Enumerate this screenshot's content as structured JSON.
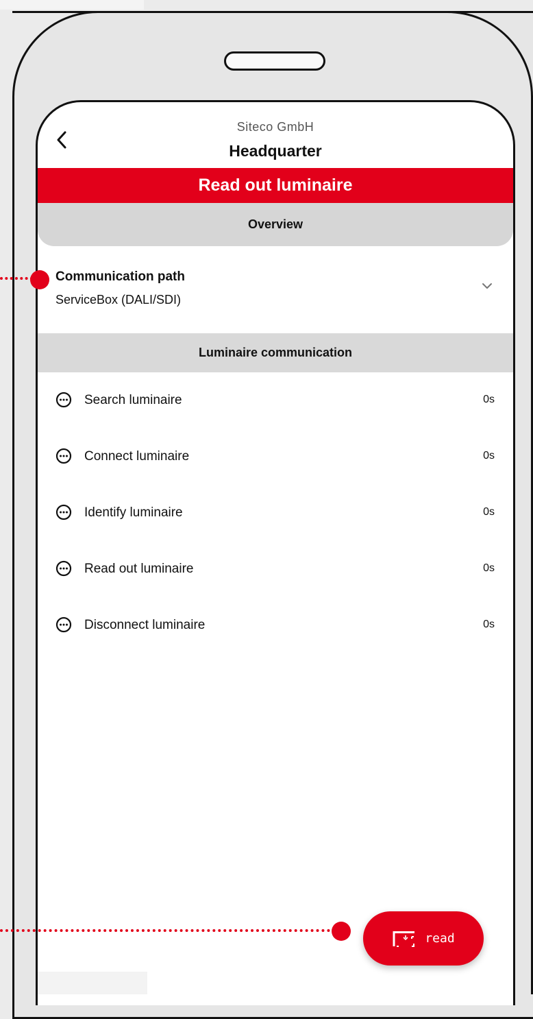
{
  "header": {
    "company": "Siteco GmbH",
    "site": "Headquarter",
    "back_icon": "chevron-left-icon"
  },
  "banner": {
    "title": "Read out luminaire"
  },
  "overview": {
    "label": "Overview"
  },
  "communication_path": {
    "label": "Communication path",
    "value": "ServiceBox (DALI/SDI)",
    "icon": "chevron-down-icon"
  },
  "luminaire_communication": {
    "label": "Luminaire communication",
    "steps": [
      {
        "name": "Search luminaire",
        "time": "0s",
        "icon": "pending-dots-icon"
      },
      {
        "name": "Connect luminaire",
        "time": "0s",
        "icon": "pending-dots-icon"
      },
      {
        "name": "Identify luminaire",
        "time": "0s",
        "icon": "pending-dots-icon"
      },
      {
        "name": "Read out luminaire",
        "time": "0s",
        "icon": "pending-dots-icon"
      },
      {
        "name": "Disconnect luminaire",
        "time": "0s",
        "icon": "pending-dots-icon"
      }
    ]
  },
  "fab": {
    "label": "read",
    "icon": "scan-luminaire-icon"
  },
  "colors": {
    "accent": "#e2001a",
    "section_bg": "#d9d9d9",
    "device_bg": "#e6e6e6"
  }
}
